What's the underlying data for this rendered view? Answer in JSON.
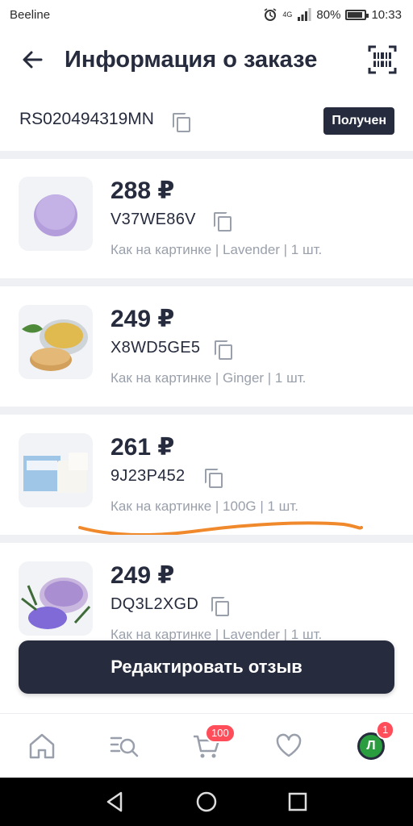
{
  "status_bar": {
    "carrier": "Beeline",
    "network": "4G",
    "battery": "80%",
    "time": "10:33"
  },
  "header": {
    "title": "Информация о заказе"
  },
  "order": {
    "id": "RS020494319MN",
    "status": "Получен"
  },
  "items": [
    {
      "price": "288 ₽",
      "sku": "V37WE86V",
      "description": "Как на картинке | Lavender | 1 шт."
    },
    {
      "price": "249 ₽",
      "sku": "X8WD5GE5",
      "description": "Как на картинке | Ginger | 1 шт."
    },
    {
      "price": "261 ₽",
      "sku": "9J23P452",
      "description": "Как на картинке | 100G | 1 шт."
    },
    {
      "price": "249 ₽",
      "sku": "DQ3L2XGD",
      "description": "Как на картинке | Lavender | 1 шт."
    }
  ],
  "edit_button": {
    "label": "Редактировать отзыв"
  },
  "bottom_nav": {
    "cart_badge": "100",
    "profile_badge": "1",
    "avatar_letter": "Л"
  },
  "colors": {
    "primary": "#262b3d",
    "secondary_text": "#9aa0ab",
    "badge": "#ff4d5a",
    "highlight_stroke": "#f0892b",
    "avatar": "#2a9d3e"
  }
}
